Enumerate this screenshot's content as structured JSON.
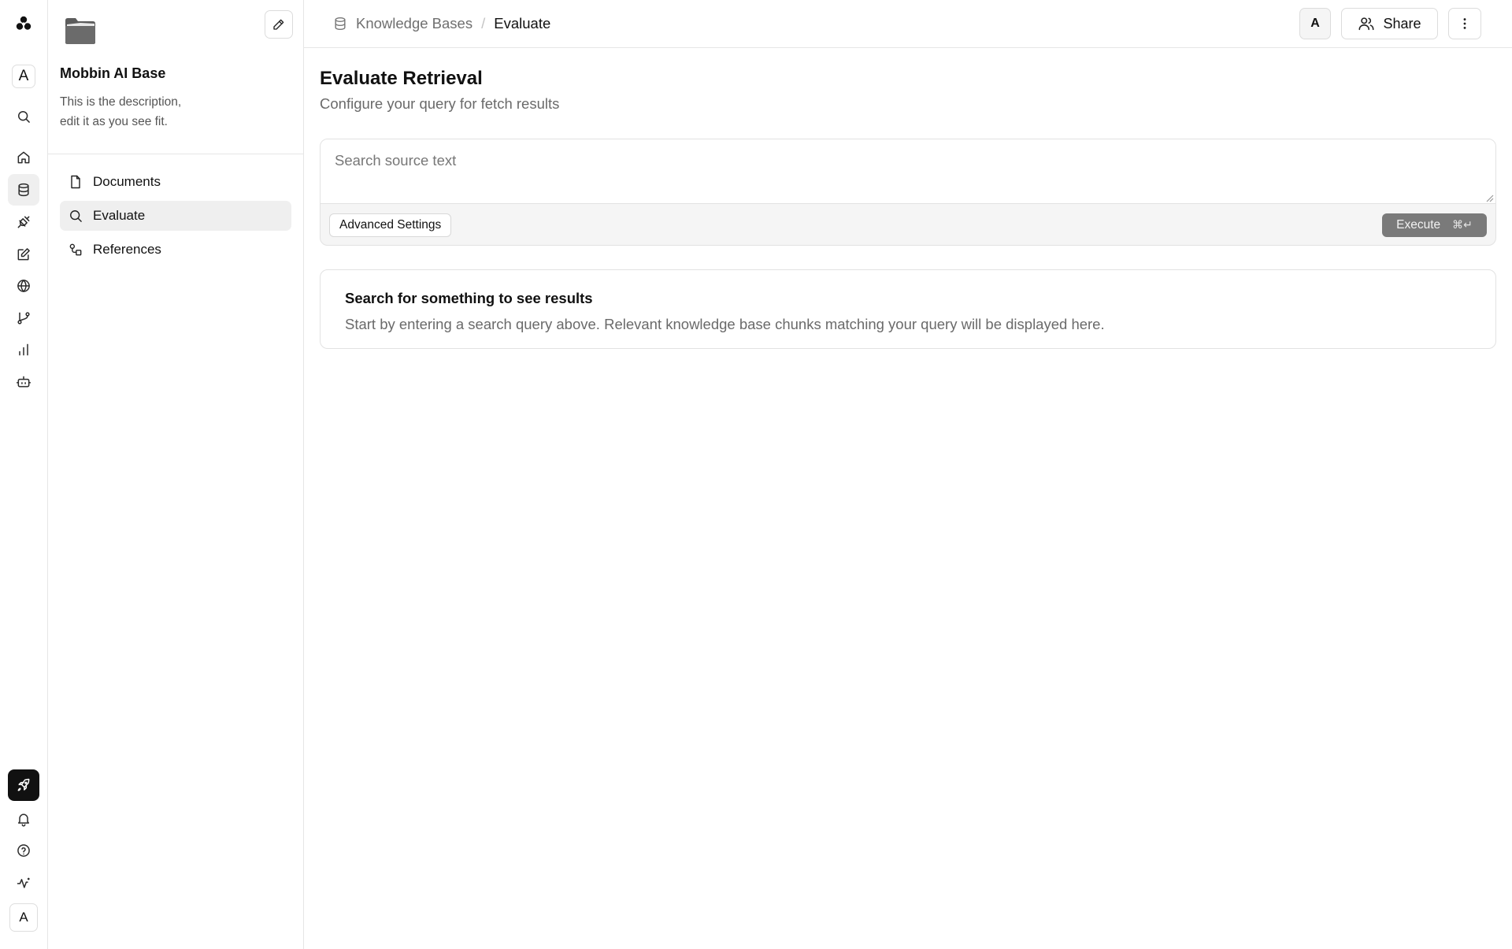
{
  "rail": {
    "workspace_avatar": "A",
    "user_avatar": "A",
    "top_items": [
      {
        "name": "search-icon",
        "active": false
      },
      {
        "name": "home-icon",
        "active": false
      },
      {
        "name": "database-icon",
        "active": true
      },
      {
        "name": "plug-icon",
        "active": false
      },
      {
        "name": "edit-square-icon",
        "active": false
      },
      {
        "name": "globe-icon",
        "active": false
      },
      {
        "name": "git-branch-icon",
        "active": false
      },
      {
        "name": "bar-chart-icon",
        "active": false
      },
      {
        "name": "bot-icon",
        "active": false
      }
    ],
    "bottom_items": [
      {
        "name": "rocket-icon",
        "highlighted": true
      },
      {
        "name": "bell-icon"
      },
      {
        "name": "help-circle-icon"
      },
      {
        "name": "activity-icon"
      }
    ]
  },
  "knowledge_base": {
    "title": "Mobbin AI Base",
    "description_line1": "This is the description,",
    "description_line2": "edit it as you see fit.",
    "nav": [
      {
        "label": "Documents",
        "icon": "file-icon",
        "active": false
      },
      {
        "label": "Evaluate",
        "icon": "search-icon",
        "active": true
      },
      {
        "label": "References",
        "icon": "references-icon",
        "active": false
      }
    ]
  },
  "header": {
    "breadcrumb_root": "Knowledge Bases",
    "breadcrumb_separator": "/",
    "breadcrumb_current": "Evaluate",
    "avatar": "A",
    "share_label": "Share"
  },
  "main": {
    "title": "Evaluate Retrieval",
    "subtitle": "Configure your query for fetch results",
    "query": {
      "placeholder": "Search source text",
      "value": "",
      "advanced_settings_label": "Advanced Settings",
      "execute_label": "Execute",
      "execute_shortcut": "⌘↵"
    },
    "results": {
      "empty_title": "Search for something to see results",
      "empty_description": "Start by entering a search query above. Relevant knowledge base chunks matching your query will be displayed here."
    }
  },
  "colors": {
    "active_background": "#efefef",
    "primary_dark": "#111111",
    "execute_disabled": "#7a7a7a",
    "border": "#e2e2e2",
    "muted_text": "#6a6a6a"
  }
}
